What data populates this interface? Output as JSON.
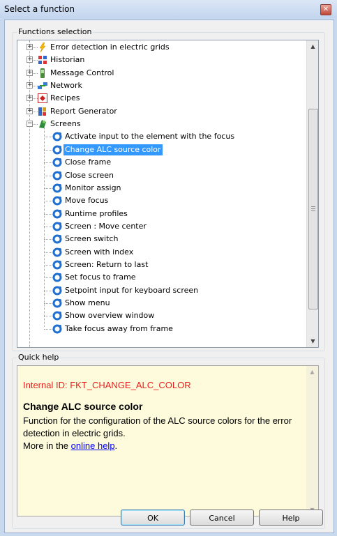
{
  "window": {
    "title": "Select a function",
    "close_symbol": "✕"
  },
  "functions_group": {
    "label": "Functions selection"
  },
  "tree": {
    "items": [
      {
        "label": "Error detection in electric grids",
        "icon": "lightning-icon",
        "level": 0,
        "expander": "+"
      },
      {
        "label": "Historian",
        "icon": "historian-icon",
        "level": 0,
        "expander": "+"
      },
      {
        "label": "Message Control",
        "icon": "phone-icon",
        "level": 0,
        "expander": "+"
      },
      {
        "label": "Network",
        "icon": "network-icon",
        "level": 0,
        "expander": "+"
      },
      {
        "label": "Recipes",
        "icon": "recipe-icon",
        "level": 0,
        "expander": "+"
      },
      {
        "label": "Report Generator",
        "icon": "report-icon",
        "level": 0,
        "expander": "+"
      },
      {
        "label": "Screens",
        "icon": "screens-icon",
        "level": 0,
        "expander": "−"
      },
      {
        "label": "Activate input to the element with the focus",
        "icon": "function-icon",
        "level": 1
      },
      {
        "label": "Change ALC source color",
        "icon": "function-icon",
        "level": 1,
        "selected": true
      },
      {
        "label": "Close frame",
        "icon": "function-icon",
        "level": 1
      },
      {
        "label": "Close screen",
        "icon": "function-icon",
        "level": 1
      },
      {
        "label": "Monitor assign",
        "icon": "function-icon",
        "level": 1
      },
      {
        "label": "Move focus",
        "icon": "function-icon",
        "level": 1
      },
      {
        "label": "Runtime profiles",
        "icon": "function-icon",
        "level": 1
      },
      {
        "label": "Screen : Move center",
        "icon": "function-icon",
        "level": 1
      },
      {
        "label": "Screen switch",
        "icon": "function-icon",
        "level": 1
      },
      {
        "label": "Screen with index",
        "icon": "function-icon",
        "level": 1
      },
      {
        "label": "Screen: Return to last",
        "icon": "function-icon",
        "level": 1
      },
      {
        "label": "Set focus to frame",
        "icon": "function-icon",
        "level": 1
      },
      {
        "label": "Setpoint input for keyboard screen",
        "icon": "function-icon",
        "level": 1
      },
      {
        "label": "Show menu",
        "icon": "function-icon",
        "level": 1
      },
      {
        "label": "Show overview window",
        "icon": "function-icon",
        "level": 1
      },
      {
        "label": "Take focus away from frame",
        "icon": "function-icon",
        "level": 1
      }
    ]
  },
  "quick_help": {
    "label": "Quick help",
    "internal_id": "Internal ID: FKT_CHANGE_ALC_COLOR",
    "title": "Change ALC source color",
    "description": "Function for the configuration of the ALC source colors for the error detection in electric grids.",
    "more_prefix": "More in the ",
    "link_text": "online help",
    "more_suffix": "."
  },
  "buttons": {
    "ok": "OK",
    "cancel": "Cancel",
    "help": "Help"
  },
  "colors": {
    "selection": "#3399ff",
    "help_bg": "#fefbdc",
    "help_id": "#e81e1e",
    "link": "#0000ee"
  }
}
